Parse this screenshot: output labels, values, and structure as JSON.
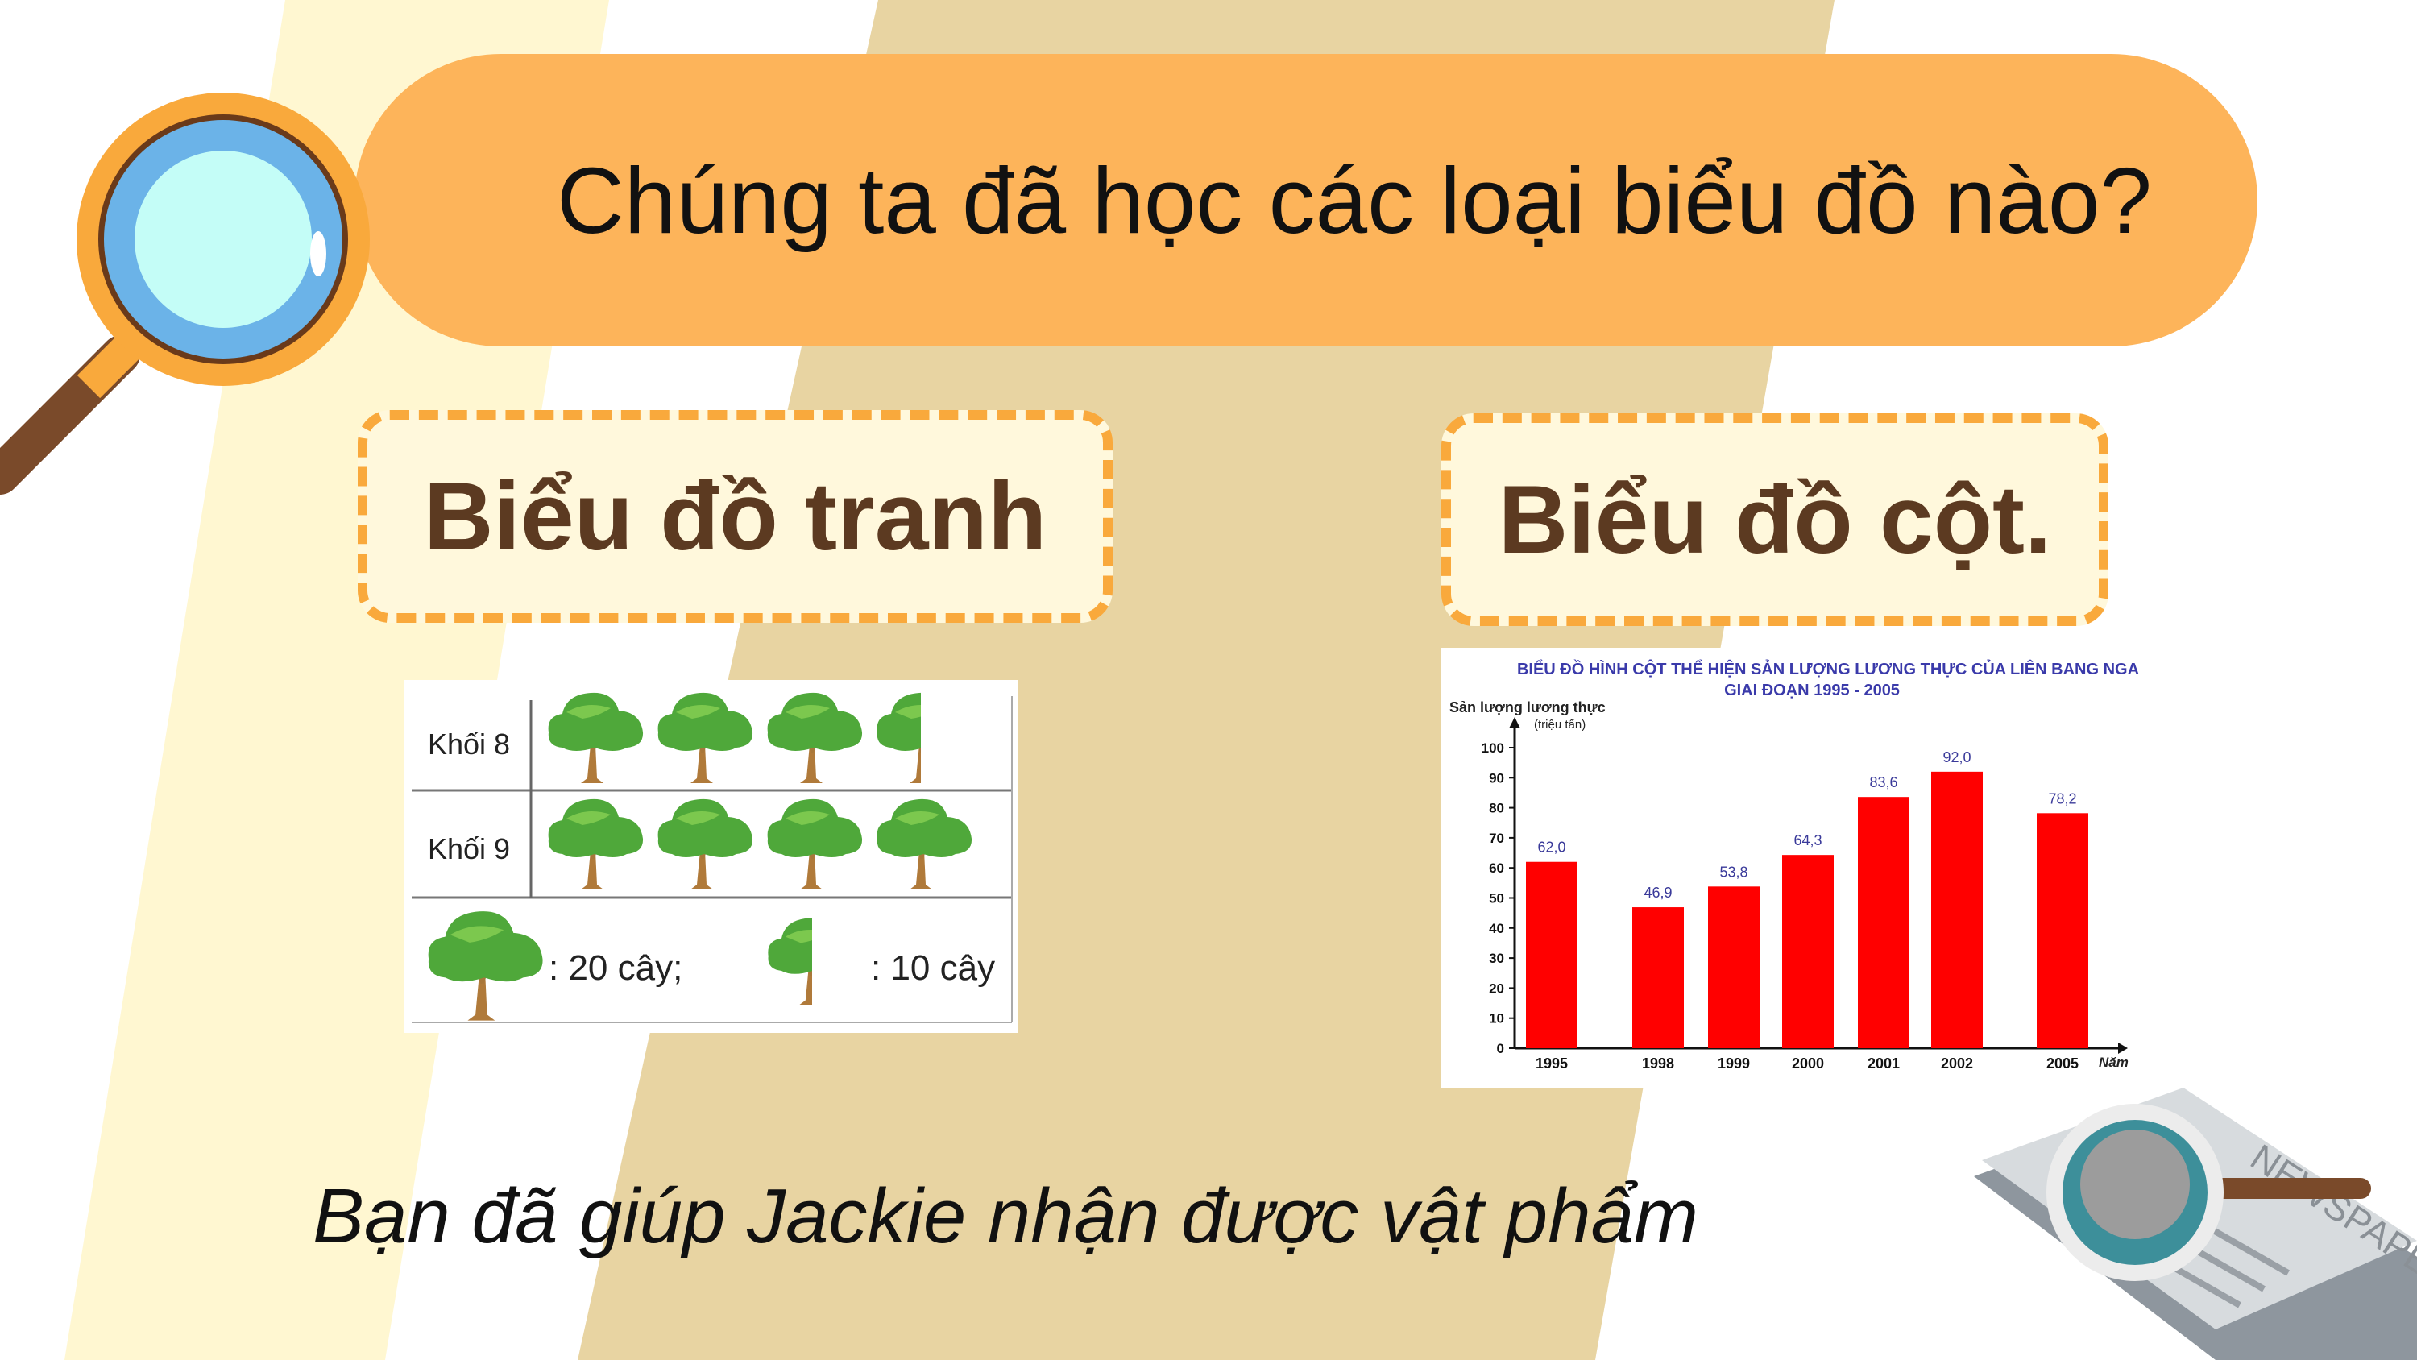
{
  "header": {
    "title": "Chúng ta đã học các loại biểu đồ nào?"
  },
  "cards": [
    {
      "label": "Biểu đồ tranh"
    },
    {
      "label": "Biểu đồ cột."
    }
  ],
  "pictograph": {
    "rows": [
      {
        "label": "Khối 8",
        "trees": 3.5
      },
      {
        "label": "Khối 9",
        "trees": 4
      }
    ],
    "legend": [
      {
        "text": ": 20 cây;",
        "value": 20
      },
      {
        "text": ": 10 cây",
        "value": 10
      }
    ]
  },
  "footer": {
    "text": "Bạn đã giúp Jackie nhận được vật phẩm"
  },
  "colors": {
    "pill": "#FDB45A",
    "card_border": "#F9A93C",
    "card_fill": "#FFF8DC",
    "card_text": "#5C3A21",
    "bar": "#FF0000",
    "value_label": "#3A3A9A",
    "title_blue": "#3A3AAA"
  },
  "icons": [
    "magnifier-icon",
    "newspaper-magnifier-icon",
    "tree-icon"
  ],
  "chart_data": {
    "type": "bar",
    "title": "BIỂU ĐỒ HÌNH CỘT THỂ HIỆN SẢN LƯỢNG LƯƠNG THỰC CỦA LIÊN BANG NGA",
    "subtitle": "GIAI ĐOẠN 1995 - 2005",
    "ylabel": "Sản lượng lương thực",
    "yunit": "(triệu tấn)",
    "xlabel": "Năm",
    "categories": [
      "1995",
      "1998",
      "1999",
      "2000",
      "2001",
      "2002",
      "2005"
    ],
    "values": [
      62.0,
      46.9,
      53.8,
      64.3,
      83.6,
      92.0,
      78.2
    ],
    "value_labels": [
      "62,0",
      "46,9",
      "53,8",
      "64,3",
      "83,6",
      "92,0",
      "78,2"
    ],
    "ylim": [
      0,
      100
    ],
    "yticks": [
      0,
      10,
      20,
      30,
      40,
      50,
      60,
      70,
      80,
      90,
      100
    ],
    "grid": false
  }
}
